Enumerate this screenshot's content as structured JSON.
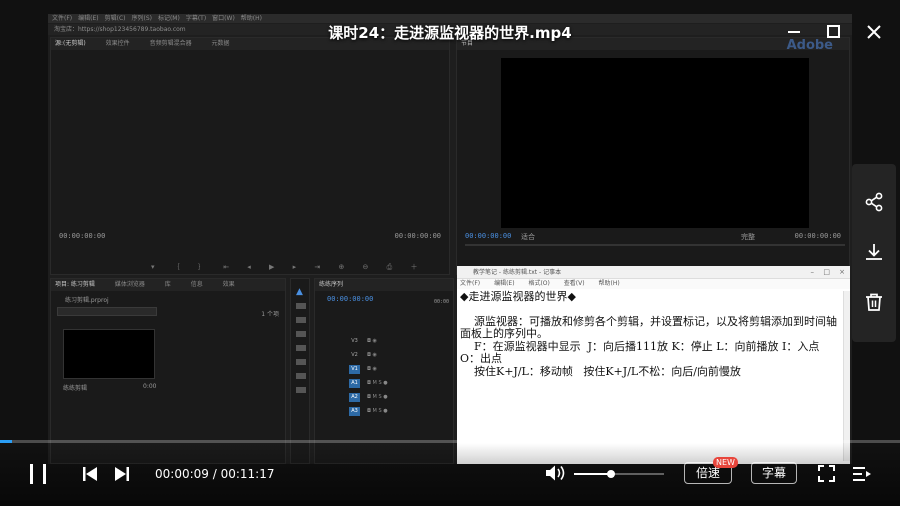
{
  "player": {
    "title": "课时24：走进源监视器的世界.mp4",
    "time_current": "00:00:09",
    "time_total": "00:11:17",
    "time_sep": " / ",
    "progress_fraction": 0.013,
    "volume_fraction": 0.41,
    "speed_label": "倍速",
    "speed_badge": "NEW",
    "subtitle_label": "字幕",
    "colors": {
      "accent": "#2a9df4",
      "badge": "#e8463c"
    },
    "icons": [
      "minimize-icon",
      "maximize-icon",
      "close-icon",
      "share-icon",
      "download-icon",
      "delete-icon",
      "pause-icon",
      "prev-icon",
      "next-icon",
      "volume-icon",
      "fullscreen-icon",
      "playlist-icon"
    ]
  },
  "premiere": {
    "url_text": "淘宝店：https://shop123456789.taobao.com",
    "source_tabs": [
      "源:(无剪辑)",
      "效果控件",
      "音频剪辑混合器",
      "元数据"
    ],
    "program_brand": "Adobe",
    "source_tc_left": "00:00:00:00",
    "source_tc_right": "00:00:00:00",
    "program_tc": "00:00:00:00",
    "program_fit": "适合",
    "program_quality": "完整",
    "program_tc_right": "00:00:00:00",
    "project_tabs": [
      "项目: 练习剪辑",
      "媒体浏览器",
      "库",
      "信息",
      "效果"
    ],
    "project_file": "练习剪辑.prproj",
    "project_count": "1 个项",
    "clip_name": "练练剪辑",
    "clip_duration": "0:00",
    "timeline_tab": "练练序列",
    "timeline_tc": "00:00:00:00",
    "timeline_ruler": "00:00",
    "tracks": [
      "V3",
      "V2",
      "V1",
      "A1",
      "A2",
      "A3"
    ]
  },
  "notepad": {
    "title": "教学笔记 - 练练剪辑.txt - 记事本",
    "menu": [
      "文件(F)",
      "编辑(E)",
      "格式(O)",
      "查看(V)",
      "帮助(H)"
    ],
    "lines": [
      "◆走进源监视器的世界◆",
      "",
      "    源监视器：可播放和修剪各个剪辑，并设置标记，以及将剪辑添加到时间轴面板上的序列中。",
      "    F：在源监视器中显示  J：向后播111放 K：停止 L：向前播放 I：入点 O：出点",
      "    按住K+J/L：移动帧   按住K+J/L不松：向后/向前慢放"
    ]
  }
}
